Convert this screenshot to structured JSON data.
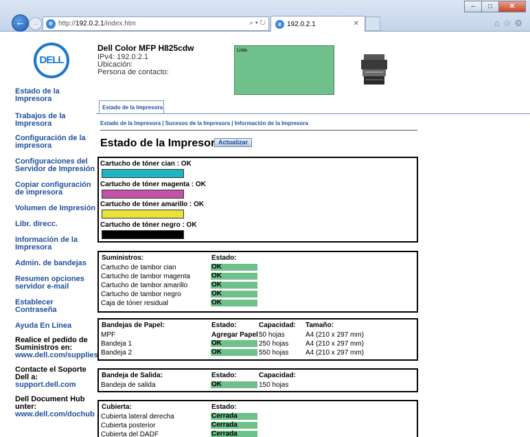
{
  "browser": {
    "url_prefix": "http://",
    "url_host": "192.0.2.1",
    "url_path": "/index.htm",
    "tab_title": "192.0.2.1",
    "address_tools": "⌕ ▾ ↻"
  },
  "device": {
    "logo_text": "DELL",
    "name": "Dell Color MFP H825cdw",
    "ipv4": "IPv4: 192.0.2.1",
    "location": "Ubicación:",
    "contact": "Persona de contacto:",
    "status_label": "Lista"
  },
  "sidebar": {
    "items": [
      "Estado de la Impresora",
      "Trabajos de la Impresora",
      "Configuración de la impresora",
      "Configuraciones del Servidor de Impresión",
      "Copiar configuración de impresora",
      "Volumen de Impresión",
      "Libr. direcc.",
      "Información de la Impresora",
      "Admin. de bandejas",
      "Resumen opciones servidor e-mail",
      "Establecer Contraseña",
      "Ayuda En Línea"
    ],
    "supplies_text": "Realice el pedido de Suministros en:",
    "supplies_link": "www.dell.com/supplies",
    "support_text": "Contacte el Soporte Dell a:",
    "support_link": "support.dell.com",
    "dochub_text": "Dell Document Hub unter:",
    "dochub_link": "www.dell.com/dochub"
  },
  "main": {
    "tab": "Estado de la Impresora",
    "subnav": [
      "Estado de la Impresora",
      "Sucesos de la Impresora",
      "Información de la Impresora"
    ],
    "subnav_sep": " | ",
    "title": "Estado de la Impresora -",
    "refresh": "Actualizar"
  },
  "toner": [
    {
      "label": "Cartucho de tóner cian : OK",
      "color": "#20b6c0"
    },
    {
      "label": "Cartucho de tóner magenta : OK",
      "color": "#c254a8"
    },
    {
      "label": "Cartucho de tóner amarillo : OK",
      "color": "#e8e23a"
    },
    {
      "label": "Cartucho de tóner negro : OK",
      "color": "#000000"
    }
  ],
  "supplies": {
    "header": "Suministros:",
    "status_header": "Estado:",
    "rows": [
      {
        "name": "Cartucho de tambor cian",
        "status": "OK"
      },
      {
        "name": "Cartucho de tambor magenta",
        "status": "OK"
      },
      {
        "name": "Cartucho de tambor amarillo",
        "status": "OK"
      },
      {
        "name": "Cartucho de tambor negro",
        "status": "OK"
      },
      {
        "name": "Caja de tóner residual",
        "status": "OK"
      }
    ]
  },
  "trays": {
    "header": "Bandejas de Papel:",
    "status_header": "Estado:",
    "capacity_header": "Capacidad:",
    "size_header": "Tamaño:",
    "rows": [
      {
        "name": "MPF",
        "status": "Agregar Papel",
        "capacity": "50 hojas",
        "size": "A4 (210 x 297 mm)"
      },
      {
        "name": "Bandeja 1",
        "status": "OK",
        "capacity": "250 hojas",
        "size": "A4 (210 x 297 mm)"
      },
      {
        "name": "Bandeja 2",
        "status": "OK",
        "capacity": "550 hojas",
        "size": "A4 (210 x 297 mm)"
      }
    ]
  },
  "output": {
    "header": "Bandeja de Salida:",
    "status_header": "Estado:",
    "capacity_header": "Capacidad:",
    "rows": [
      {
        "name": "Bandeja de salida",
        "status": "OK",
        "capacity": "150 hojas"
      }
    ]
  },
  "covers": {
    "header": "Cubierta:",
    "status_header": "Estado:",
    "rows": [
      {
        "name": "Cubierta lateral derecha",
        "status": "Cerrada"
      },
      {
        "name": "Cubierta posterior",
        "status": "Cerrada"
      },
      {
        "name": "Cubierta del DADF",
        "status": "Cerrada"
      }
    ]
  }
}
